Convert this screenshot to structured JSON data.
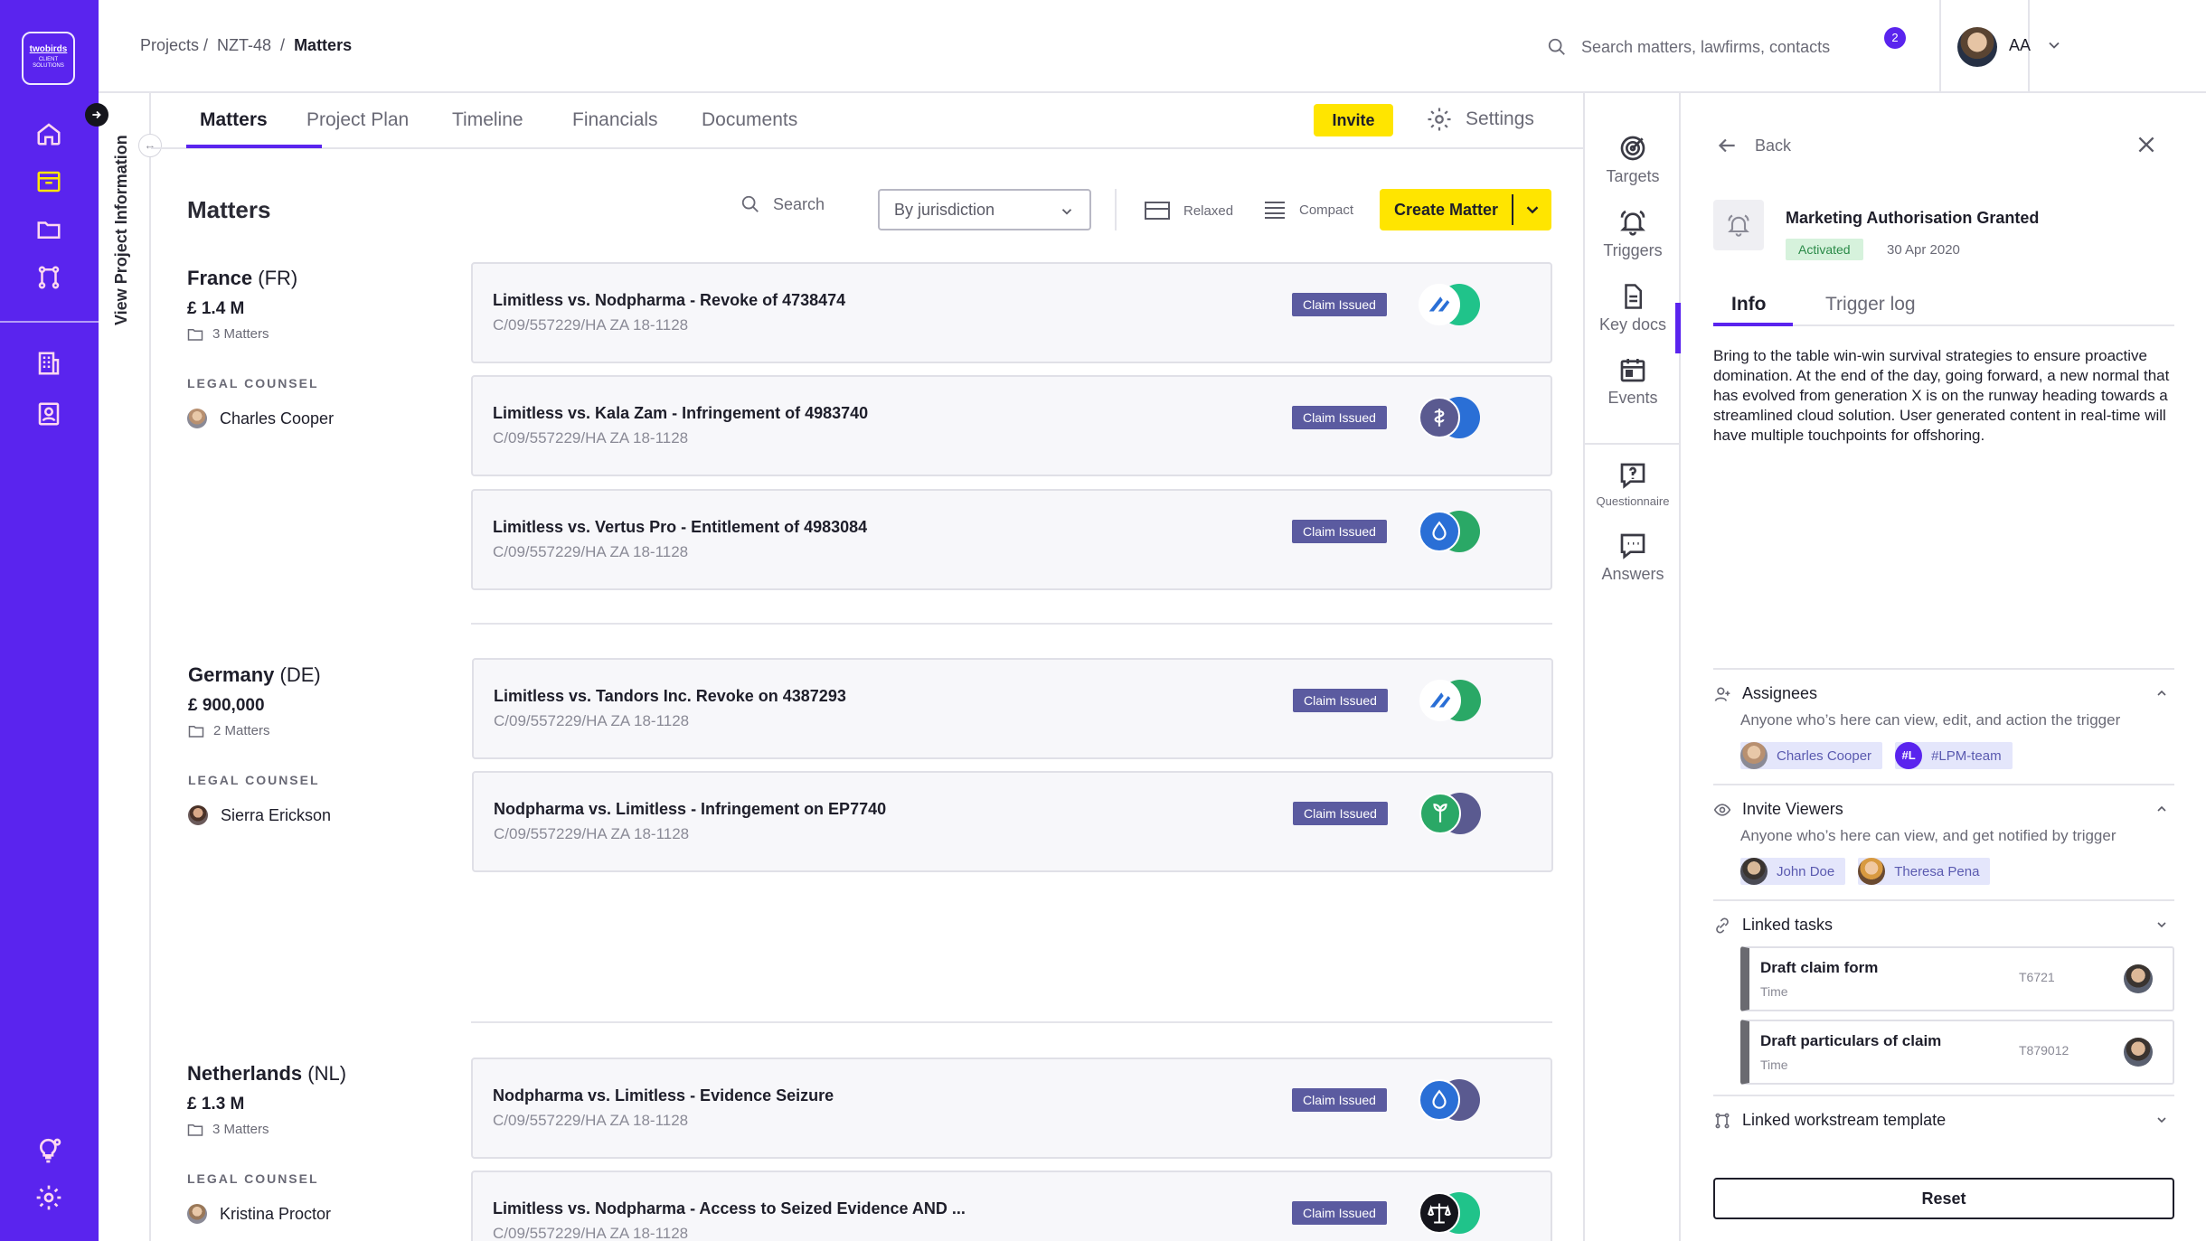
{
  "logo": {
    "line1": "twobirds",
    "line2": "CLIENT SOLUTIONS"
  },
  "rail": {
    "items": [
      "home-icon",
      "inbox-icon",
      "folder-icon",
      "workflow-icon",
      "building-icon",
      "contact-icon"
    ],
    "bottom": [
      "lightbulb-gear-icon",
      "settings-icon"
    ],
    "color": "#5a24ee"
  },
  "breadcrumb": {
    "root": "Projects /",
    "project": "NZT-48",
    "sep": "/",
    "current": "Matters"
  },
  "global_search": {
    "placeholder": "Search matters, lawfirms, contacts"
  },
  "notifications": {
    "count": "2"
  },
  "user": {
    "initials": "AA"
  },
  "project_info": {
    "label": "View Project Information"
  },
  "tabs": {
    "items": [
      "Matters",
      "Project Plan",
      "Timeline",
      "Financials",
      "Documents"
    ],
    "active": "Matters"
  },
  "invite_label": "Invite",
  "settings_label": "Settings",
  "matters": {
    "title": "Matters",
    "search_label": "Search",
    "filter_value": "By jurisdiction",
    "relaxed_label": "Relaxed",
    "compact_label": "Compact",
    "create_label": "Create Matter",
    "groups": [
      {
        "country": "France",
        "code": "(FR)",
        "amount": "£ 1.4 M",
        "count": "3 Matters",
        "counsel_label": "LEGAL COUNSEL",
        "counsel": "Charles Cooper",
        "items": [
          {
            "title": "Limitless vs. Nodpharma - Revoke of 4738474",
            "ref": "C/09/557229/HA ZA 18-1128",
            "status": "Claim Issued"
          },
          {
            "title": "Limitless vs. Kala Zam - Infringement of 4983740",
            "ref": "C/09/557229/HA ZA 18-1128",
            "status": "Claim Issued"
          },
          {
            "title": "Limitless vs. Vertus Pro - Entitlement of 4983084",
            "ref": "C/09/557229/HA ZA 18-1128",
            "status": "Claim Issued"
          }
        ]
      },
      {
        "country": "Germany",
        "code": "(DE)",
        "amount": "£ 900,000",
        "count": "2 Matters",
        "counsel_label": "LEGAL COUNSEL",
        "counsel": "Sierra Erickson",
        "items": [
          {
            "title": "Limitless vs. Tandors Inc. Revoke on 4387293",
            "ref": "C/09/557229/HA ZA 18-1128",
            "status": "Claim Issued"
          },
          {
            "title": "Nodpharma vs. Limitless - Infringement on EP7740",
            "ref": "C/09/557229/HA ZA 18-1128",
            "status": "Claim Issued"
          }
        ]
      },
      {
        "country": "Netherlands",
        "code": "(NL)",
        "amount": "£ 1.3 M",
        "count": "3 Matters",
        "counsel_label": "LEGAL COUNSEL",
        "counsel": "Kristina Proctor",
        "items": [
          {
            "title": "Nodpharma vs. Limitless - Evidence Seizure",
            "ref": "C/09/557229/HA ZA 18-1128",
            "status": "Claim Issued"
          },
          {
            "title": "Limitless vs. Nodpharma - Access to Seized Evidence AND ...",
            "ref": "C/09/557229/HA ZA 18-1128",
            "status": "Claim Issued"
          }
        ]
      }
    ]
  },
  "icon_column": {
    "items": [
      {
        "label": "Targets",
        "icon": "target-icon"
      },
      {
        "label": "Triggers",
        "icon": "bell-icon"
      },
      {
        "label": "Key docs",
        "icon": "document-icon"
      },
      {
        "label": "Events",
        "icon": "calendar-icon"
      },
      {
        "label": "Questionnaire",
        "icon": "question-icon"
      },
      {
        "label": "Answers",
        "icon": "chat-icon"
      }
    ],
    "active": "Triggers"
  },
  "trigger": {
    "back_label": "Back",
    "title": "Marketing Authorisation Granted",
    "status": "Activated",
    "date": "30 Apr 2020",
    "tabs": [
      "Info",
      "Trigger log"
    ],
    "description": "Bring to the table win-win survival strategies to ensure proactive domination. At the end of the day, going forward, a new normal that has evolved from generation X is on the runway heading towards a streamlined cloud solution. User generated content in real-time will have multiple touchpoints for offshoring.",
    "assignees": {
      "title": "Assignees",
      "subtitle": "Anyone who’s here can view, edit, and action the trigger",
      "people": [
        "Charles Cooper"
      ],
      "team": {
        "initials": "#L",
        "name": "#LPM-team"
      }
    },
    "viewers": {
      "title": "Invite Viewers",
      "subtitle": "Anyone who’s here can view, and get notified by trigger",
      "people": [
        "John Doe",
        "Theresa Pena"
      ]
    },
    "linked_tasks": {
      "title": "Linked tasks",
      "items": [
        {
          "title": "Draft claim form",
          "sub": "Time",
          "id": "T6721"
        },
        {
          "title": "Draft particulars of claim",
          "sub": "Time",
          "id": "T879012"
        }
      ]
    },
    "linked_template": {
      "title": "Linked workstream template"
    },
    "reset_label": "Reset"
  }
}
